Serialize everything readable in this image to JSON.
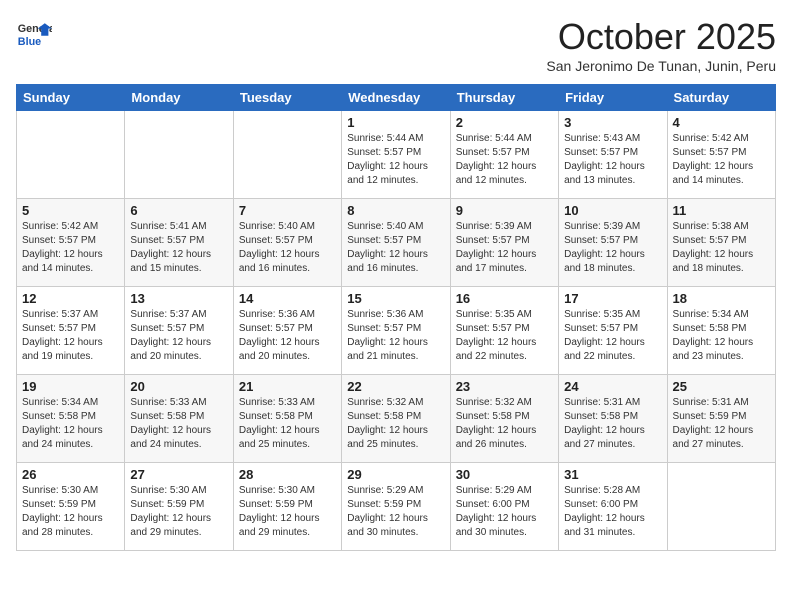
{
  "header": {
    "logo_general": "General",
    "logo_blue": "Blue",
    "month_title": "October 2025",
    "subtitle": "San Jeronimo De Tunan, Junin, Peru"
  },
  "weekdays": [
    "Sunday",
    "Monday",
    "Tuesday",
    "Wednesday",
    "Thursday",
    "Friday",
    "Saturday"
  ],
  "weeks": [
    [
      {
        "day": "",
        "info": ""
      },
      {
        "day": "",
        "info": ""
      },
      {
        "day": "",
        "info": ""
      },
      {
        "day": "1",
        "info": "Sunrise: 5:44 AM\nSunset: 5:57 PM\nDaylight: 12 hours\nand 12 minutes."
      },
      {
        "day": "2",
        "info": "Sunrise: 5:44 AM\nSunset: 5:57 PM\nDaylight: 12 hours\nand 12 minutes."
      },
      {
        "day": "3",
        "info": "Sunrise: 5:43 AM\nSunset: 5:57 PM\nDaylight: 12 hours\nand 13 minutes."
      },
      {
        "day": "4",
        "info": "Sunrise: 5:42 AM\nSunset: 5:57 PM\nDaylight: 12 hours\nand 14 minutes."
      }
    ],
    [
      {
        "day": "5",
        "info": "Sunrise: 5:42 AM\nSunset: 5:57 PM\nDaylight: 12 hours\nand 14 minutes."
      },
      {
        "day": "6",
        "info": "Sunrise: 5:41 AM\nSunset: 5:57 PM\nDaylight: 12 hours\nand 15 minutes."
      },
      {
        "day": "7",
        "info": "Sunrise: 5:40 AM\nSunset: 5:57 PM\nDaylight: 12 hours\nand 16 minutes."
      },
      {
        "day": "8",
        "info": "Sunrise: 5:40 AM\nSunset: 5:57 PM\nDaylight: 12 hours\nand 16 minutes."
      },
      {
        "day": "9",
        "info": "Sunrise: 5:39 AM\nSunset: 5:57 PM\nDaylight: 12 hours\nand 17 minutes."
      },
      {
        "day": "10",
        "info": "Sunrise: 5:39 AM\nSunset: 5:57 PM\nDaylight: 12 hours\nand 18 minutes."
      },
      {
        "day": "11",
        "info": "Sunrise: 5:38 AM\nSunset: 5:57 PM\nDaylight: 12 hours\nand 18 minutes."
      }
    ],
    [
      {
        "day": "12",
        "info": "Sunrise: 5:37 AM\nSunset: 5:57 PM\nDaylight: 12 hours\nand 19 minutes."
      },
      {
        "day": "13",
        "info": "Sunrise: 5:37 AM\nSunset: 5:57 PM\nDaylight: 12 hours\nand 20 minutes."
      },
      {
        "day": "14",
        "info": "Sunrise: 5:36 AM\nSunset: 5:57 PM\nDaylight: 12 hours\nand 20 minutes."
      },
      {
        "day": "15",
        "info": "Sunrise: 5:36 AM\nSunset: 5:57 PM\nDaylight: 12 hours\nand 21 minutes."
      },
      {
        "day": "16",
        "info": "Sunrise: 5:35 AM\nSunset: 5:57 PM\nDaylight: 12 hours\nand 22 minutes."
      },
      {
        "day": "17",
        "info": "Sunrise: 5:35 AM\nSunset: 5:57 PM\nDaylight: 12 hours\nand 22 minutes."
      },
      {
        "day": "18",
        "info": "Sunrise: 5:34 AM\nSunset: 5:58 PM\nDaylight: 12 hours\nand 23 minutes."
      }
    ],
    [
      {
        "day": "19",
        "info": "Sunrise: 5:34 AM\nSunset: 5:58 PM\nDaylight: 12 hours\nand 24 minutes."
      },
      {
        "day": "20",
        "info": "Sunrise: 5:33 AM\nSunset: 5:58 PM\nDaylight: 12 hours\nand 24 minutes."
      },
      {
        "day": "21",
        "info": "Sunrise: 5:33 AM\nSunset: 5:58 PM\nDaylight: 12 hours\nand 25 minutes."
      },
      {
        "day": "22",
        "info": "Sunrise: 5:32 AM\nSunset: 5:58 PM\nDaylight: 12 hours\nand 25 minutes."
      },
      {
        "day": "23",
        "info": "Sunrise: 5:32 AM\nSunset: 5:58 PM\nDaylight: 12 hours\nand 26 minutes."
      },
      {
        "day": "24",
        "info": "Sunrise: 5:31 AM\nSunset: 5:58 PM\nDaylight: 12 hours\nand 27 minutes."
      },
      {
        "day": "25",
        "info": "Sunrise: 5:31 AM\nSunset: 5:59 PM\nDaylight: 12 hours\nand 27 minutes."
      }
    ],
    [
      {
        "day": "26",
        "info": "Sunrise: 5:30 AM\nSunset: 5:59 PM\nDaylight: 12 hours\nand 28 minutes."
      },
      {
        "day": "27",
        "info": "Sunrise: 5:30 AM\nSunset: 5:59 PM\nDaylight: 12 hours\nand 29 minutes."
      },
      {
        "day": "28",
        "info": "Sunrise: 5:30 AM\nSunset: 5:59 PM\nDaylight: 12 hours\nand 29 minutes."
      },
      {
        "day": "29",
        "info": "Sunrise: 5:29 AM\nSunset: 5:59 PM\nDaylight: 12 hours\nand 30 minutes."
      },
      {
        "day": "30",
        "info": "Sunrise: 5:29 AM\nSunset: 6:00 PM\nDaylight: 12 hours\nand 30 minutes."
      },
      {
        "day": "31",
        "info": "Sunrise: 5:28 AM\nSunset: 6:00 PM\nDaylight: 12 hours\nand 31 minutes."
      },
      {
        "day": "",
        "info": ""
      }
    ]
  ]
}
